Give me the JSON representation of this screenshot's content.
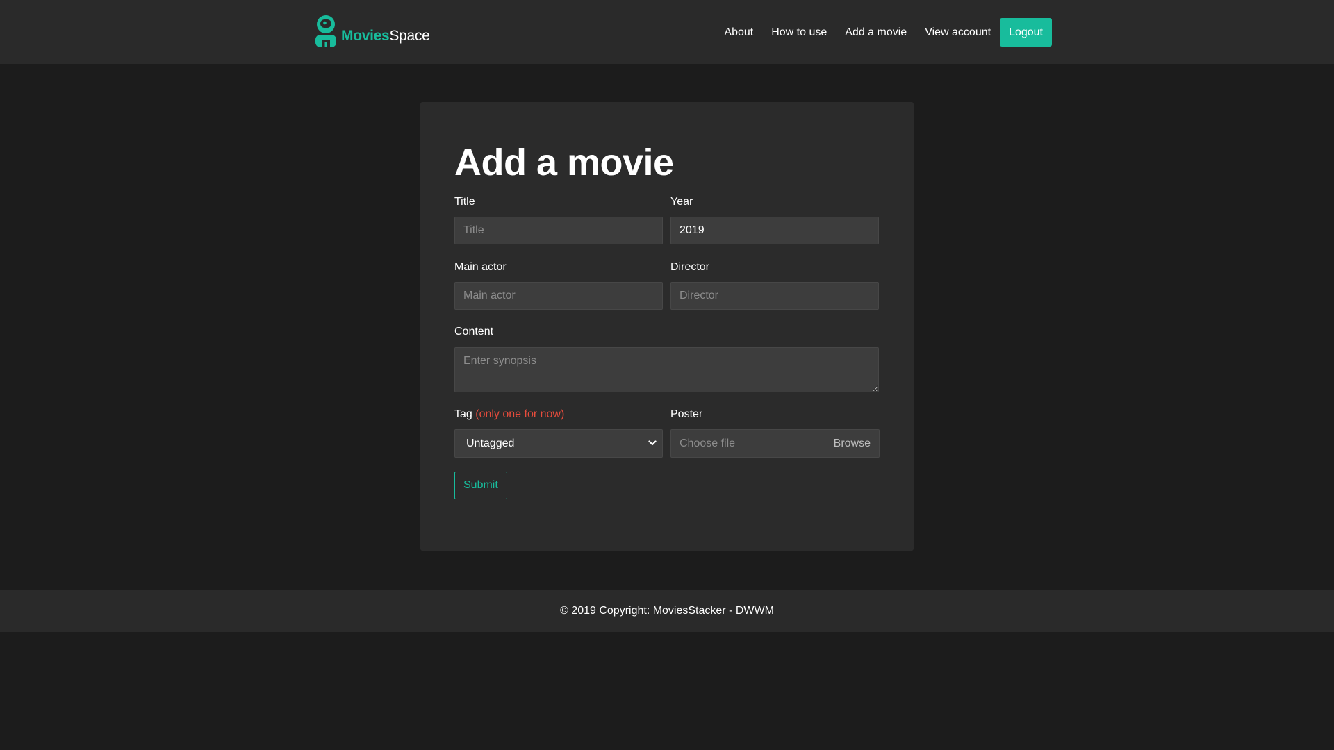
{
  "colors": {
    "accent": "#18bc9c",
    "danger": "#e74c3c",
    "navbar_bg": "#2a2a2a",
    "page_bg": "#1c1c1c",
    "card_bg": "#2b2b2b",
    "input_bg": "#3d3d3d"
  },
  "brand": {
    "icon": "astronaut-logo-icon",
    "name_bold": "Movies",
    "name_light": "Space"
  },
  "nav": {
    "items": [
      {
        "label": "About"
      },
      {
        "label": "How to use"
      },
      {
        "label": "Add a movie"
      },
      {
        "label": "View account"
      }
    ],
    "logout_label": "Logout"
  },
  "form": {
    "heading": "Add a movie",
    "title": {
      "label": "Title",
      "placeholder": "Title",
      "value": ""
    },
    "year": {
      "label": "Year",
      "value": "2019"
    },
    "main_actor": {
      "label": "Main actor",
      "placeholder": "Main actor",
      "value": ""
    },
    "director": {
      "label": "Director",
      "placeholder": "Director",
      "value": ""
    },
    "content": {
      "label": "Content",
      "placeholder": "Enter synopsis"
    },
    "tag": {
      "label": "Tag",
      "note": "(only one for now)",
      "selected": "Untagged",
      "icon": "chevron-down-icon"
    },
    "poster": {
      "label": "Poster",
      "placeholder": "Choose file",
      "browse_label": "Browse"
    },
    "submit_label": "Submit"
  },
  "footer": {
    "text": "© 2019 Copyright: MoviesStacker - DWWM"
  }
}
